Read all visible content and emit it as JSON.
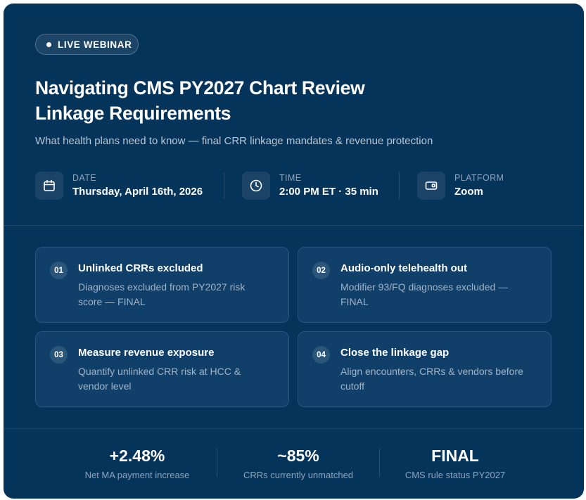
{
  "badge": {
    "label": "LIVE WEBINAR"
  },
  "title": {
    "line1": "Navigating CMS PY2027 Chart Review",
    "line2": "Linkage Requirements"
  },
  "subtitle": "What health plans need to know — final CRR linkage mandates & revenue protection",
  "meta": [
    {
      "icon": "calendar-icon",
      "label": "DATE",
      "value": "Thursday, April 16th, 2026"
    },
    {
      "icon": "clock-icon",
      "label": "TIME",
      "value": "2:00 PM ET · 35 min"
    },
    {
      "icon": "video-icon",
      "label": "PLATFORM",
      "value": "Zoom"
    }
  ],
  "features": [
    {
      "num": "01",
      "title": "Unlinked CRRs excluded",
      "desc": "Diagnoses excluded from PY2027 risk score — FINAL"
    },
    {
      "num": "02",
      "title": "Audio-only telehealth out",
      "desc": "Modifier 93/FQ diagnoses excluded — FINAL"
    },
    {
      "num": "03",
      "title": "Measure revenue exposure",
      "desc": "Quantify unlinked CRR risk at HCC & vendor level"
    },
    {
      "num": "04",
      "title": "Close the linkage gap",
      "desc": "Align encounters, CRRs & vendors before cutoff"
    }
  ],
  "stats": [
    {
      "value": "+2.48%",
      "label": "Net MA payment increase"
    },
    {
      "value": "~85%",
      "label": "CRRs currently unmatched"
    },
    {
      "value": "FINAL",
      "label": "CMS rule status PY2027"
    }
  ],
  "colors": {
    "background": "#04345a",
    "card": "#10406a",
    "accent_text": "#9fb3c7"
  }
}
